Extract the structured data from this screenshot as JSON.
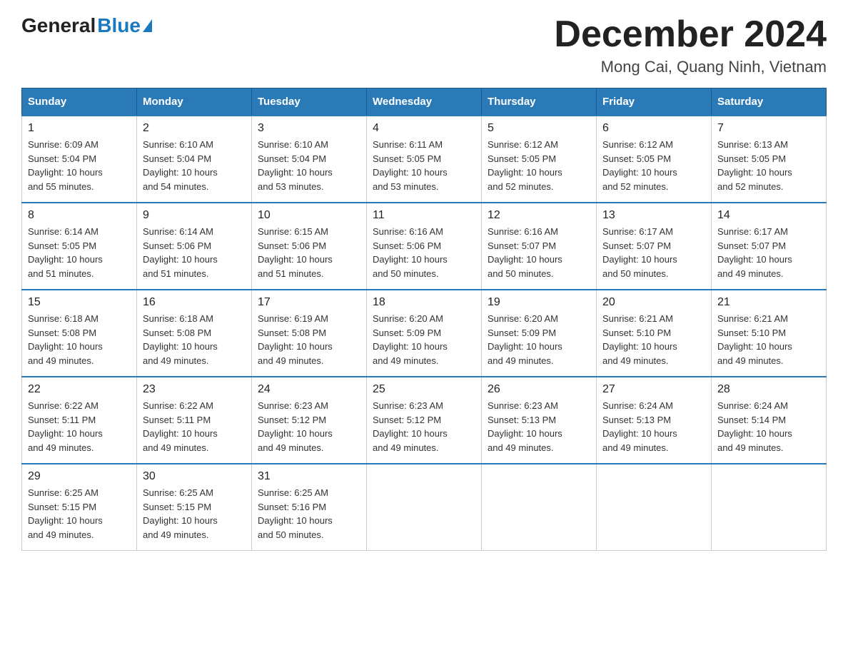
{
  "logo": {
    "general": "General",
    "blue": "Blue",
    "arrow_color": "#1a7abf"
  },
  "title": "December 2024",
  "subtitle": "Mong Cai, Quang Ninh, Vietnam",
  "days_of_week": [
    "Sunday",
    "Monday",
    "Tuesday",
    "Wednesday",
    "Thursday",
    "Friday",
    "Saturday"
  ],
  "weeks": [
    [
      {
        "day": "1",
        "info": "Sunrise: 6:09 AM\nSunset: 5:04 PM\nDaylight: 10 hours\nand 55 minutes."
      },
      {
        "day": "2",
        "info": "Sunrise: 6:10 AM\nSunset: 5:04 PM\nDaylight: 10 hours\nand 54 minutes."
      },
      {
        "day": "3",
        "info": "Sunrise: 6:10 AM\nSunset: 5:04 PM\nDaylight: 10 hours\nand 53 minutes."
      },
      {
        "day": "4",
        "info": "Sunrise: 6:11 AM\nSunset: 5:05 PM\nDaylight: 10 hours\nand 53 minutes."
      },
      {
        "day": "5",
        "info": "Sunrise: 6:12 AM\nSunset: 5:05 PM\nDaylight: 10 hours\nand 52 minutes."
      },
      {
        "day": "6",
        "info": "Sunrise: 6:12 AM\nSunset: 5:05 PM\nDaylight: 10 hours\nand 52 minutes."
      },
      {
        "day": "7",
        "info": "Sunrise: 6:13 AM\nSunset: 5:05 PM\nDaylight: 10 hours\nand 52 minutes."
      }
    ],
    [
      {
        "day": "8",
        "info": "Sunrise: 6:14 AM\nSunset: 5:05 PM\nDaylight: 10 hours\nand 51 minutes."
      },
      {
        "day": "9",
        "info": "Sunrise: 6:14 AM\nSunset: 5:06 PM\nDaylight: 10 hours\nand 51 minutes."
      },
      {
        "day": "10",
        "info": "Sunrise: 6:15 AM\nSunset: 5:06 PM\nDaylight: 10 hours\nand 51 minutes."
      },
      {
        "day": "11",
        "info": "Sunrise: 6:16 AM\nSunset: 5:06 PM\nDaylight: 10 hours\nand 50 minutes."
      },
      {
        "day": "12",
        "info": "Sunrise: 6:16 AM\nSunset: 5:07 PM\nDaylight: 10 hours\nand 50 minutes."
      },
      {
        "day": "13",
        "info": "Sunrise: 6:17 AM\nSunset: 5:07 PM\nDaylight: 10 hours\nand 50 minutes."
      },
      {
        "day": "14",
        "info": "Sunrise: 6:17 AM\nSunset: 5:07 PM\nDaylight: 10 hours\nand 49 minutes."
      }
    ],
    [
      {
        "day": "15",
        "info": "Sunrise: 6:18 AM\nSunset: 5:08 PM\nDaylight: 10 hours\nand 49 minutes."
      },
      {
        "day": "16",
        "info": "Sunrise: 6:18 AM\nSunset: 5:08 PM\nDaylight: 10 hours\nand 49 minutes."
      },
      {
        "day": "17",
        "info": "Sunrise: 6:19 AM\nSunset: 5:08 PM\nDaylight: 10 hours\nand 49 minutes."
      },
      {
        "day": "18",
        "info": "Sunrise: 6:20 AM\nSunset: 5:09 PM\nDaylight: 10 hours\nand 49 minutes."
      },
      {
        "day": "19",
        "info": "Sunrise: 6:20 AM\nSunset: 5:09 PM\nDaylight: 10 hours\nand 49 minutes."
      },
      {
        "day": "20",
        "info": "Sunrise: 6:21 AM\nSunset: 5:10 PM\nDaylight: 10 hours\nand 49 minutes."
      },
      {
        "day": "21",
        "info": "Sunrise: 6:21 AM\nSunset: 5:10 PM\nDaylight: 10 hours\nand 49 minutes."
      }
    ],
    [
      {
        "day": "22",
        "info": "Sunrise: 6:22 AM\nSunset: 5:11 PM\nDaylight: 10 hours\nand 49 minutes."
      },
      {
        "day": "23",
        "info": "Sunrise: 6:22 AM\nSunset: 5:11 PM\nDaylight: 10 hours\nand 49 minutes."
      },
      {
        "day": "24",
        "info": "Sunrise: 6:23 AM\nSunset: 5:12 PM\nDaylight: 10 hours\nand 49 minutes."
      },
      {
        "day": "25",
        "info": "Sunrise: 6:23 AM\nSunset: 5:12 PM\nDaylight: 10 hours\nand 49 minutes."
      },
      {
        "day": "26",
        "info": "Sunrise: 6:23 AM\nSunset: 5:13 PM\nDaylight: 10 hours\nand 49 minutes."
      },
      {
        "day": "27",
        "info": "Sunrise: 6:24 AM\nSunset: 5:13 PM\nDaylight: 10 hours\nand 49 minutes."
      },
      {
        "day": "28",
        "info": "Sunrise: 6:24 AM\nSunset: 5:14 PM\nDaylight: 10 hours\nand 49 minutes."
      }
    ],
    [
      {
        "day": "29",
        "info": "Sunrise: 6:25 AM\nSunset: 5:15 PM\nDaylight: 10 hours\nand 49 minutes."
      },
      {
        "day": "30",
        "info": "Sunrise: 6:25 AM\nSunset: 5:15 PM\nDaylight: 10 hours\nand 49 minutes."
      },
      {
        "day": "31",
        "info": "Sunrise: 6:25 AM\nSunset: 5:16 PM\nDaylight: 10 hours\nand 50 minutes."
      },
      {
        "day": "",
        "info": ""
      },
      {
        "day": "",
        "info": ""
      },
      {
        "day": "",
        "info": ""
      },
      {
        "day": "",
        "info": ""
      }
    ]
  ]
}
